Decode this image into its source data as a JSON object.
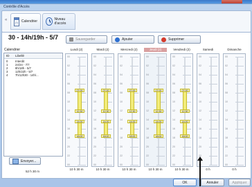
{
  "window_title": "Contrôle d'Accès",
  "tabs": [
    {
      "label": "Calendrier",
      "icon": "calendar-icon",
      "icon_text": "21"
    },
    {
      "label": "Niveau d'accès",
      "icon": "clock-icon"
    }
  ],
  "header": {
    "title": "30 - 14h/19h - 5/7",
    "save_label": "Sauvegarder",
    "add_label": "Ajouter",
    "delete_label": "Supprimer"
  },
  "calendar": {
    "section_label": "Calendrier",
    "columns": [
      "ID",
      "Libellé"
    ],
    "rows": [
      {
        "id": "0",
        "label": "Interdit"
      },
      {
        "id": "1",
        "label": "24/24 - 7/7"
      },
      {
        "id": "2",
        "label": "8h/18h - 5/7"
      },
      {
        "id": "3",
        "label": "12h/22h - 5/7"
      },
      {
        "id": "4",
        "label": "7h/12h30 - 14h/..."
      }
    ],
    "send_label": "Envoyer...",
    "total": "52 h 30 m"
  },
  "days": [
    {
      "name": "Lundi (2)",
      "total": "10 h 30 m",
      "blocks": [
        [
          7,
          12.5
        ],
        [
          14,
          18
        ]
      ],
      "labels": [
        "07:00",
        "12:30",
        "14:00",
        "18:00"
      ]
    },
    {
      "name": "Mardi (2)",
      "total": "10 h 30 m",
      "blocks": [
        [
          7,
          12.5
        ],
        [
          14,
          18
        ]
      ],
      "labels": [
        "07:00",
        "12:30",
        "14:00",
        "18:00"
      ]
    },
    {
      "name": "Mercredi (2)",
      "total": "10 h 30 m",
      "blocks": [
        [
          7,
          12.5
        ],
        [
          14,
          18
        ]
      ],
      "labels": [
        "07:00",
        "12:30",
        "14:00",
        "18:00"
      ]
    },
    {
      "name": "Jeudi (2)",
      "total": "10 h 30 m",
      "blocks": [
        [
          7,
          12.5
        ],
        [
          14,
          18
        ]
      ],
      "labels": [
        "07:00",
        "12:30",
        "14:00",
        "18:00"
      ],
      "highlight": true
    },
    {
      "name": "Vendredi (2)",
      "total": "10 h 30 m",
      "blocks": [
        [
          7,
          12.5
        ],
        [
          14,
          18
        ]
      ],
      "labels": [
        "07:00",
        "12:30",
        "14:00",
        "18:00"
      ]
    },
    {
      "name": "Samedi",
      "total": "0 h",
      "blocks": [],
      "labels": []
    },
    {
      "name": "Dimanche",
      "total": "0 h",
      "blocks": [],
      "labels": []
    }
  ],
  "hour_ticks": [
    "00",
    "02",
    "04",
    "06",
    "08",
    "10",
    "12",
    "14",
    "16",
    "18",
    "20",
    "22",
    "00"
  ],
  "footer": {
    "ok_label": "OK",
    "cancel_label": "Annuler",
    "apply_label": "Appliquer"
  },
  "colors": {
    "block": "#f2ec7a",
    "highlight_day": "#d9a0a0",
    "accent": "#2d6fd0"
  }
}
